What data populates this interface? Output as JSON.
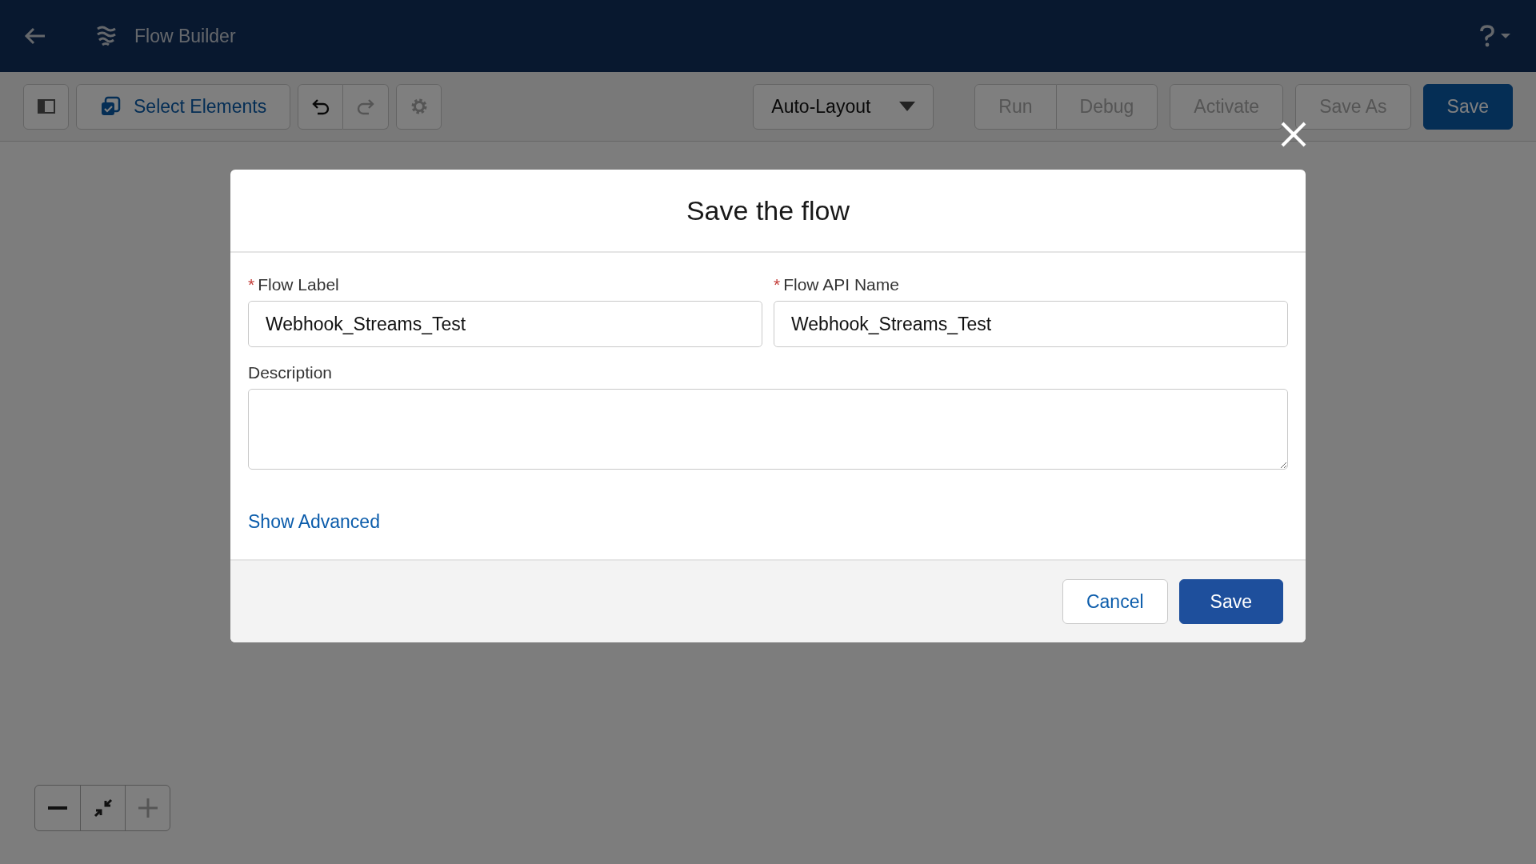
{
  "header": {
    "title": "Flow Builder"
  },
  "toolbar": {
    "select_label": "Select Elements",
    "undo": {
      "disabled": false
    },
    "redo": {
      "disabled": true
    },
    "settings": {
      "disabled": true
    },
    "layout_menu": "Auto-Layout",
    "button_groups": [
      [
        {
          "label": "Run",
          "disabled": true,
          "kind": "neutral"
        },
        {
          "label": "Debug",
          "disabled": true,
          "kind": "neutral"
        }
      ],
      [
        {
          "label": "Activate",
          "disabled": true,
          "kind": "neutral"
        }
      ],
      [
        {
          "label": "Save As",
          "disabled": true,
          "kind": "neutral"
        }
      ],
      [
        {
          "label": "Save",
          "disabled": false,
          "kind": "brand"
        }
      ]
    ]
  },
  "zoom_controls": [
    {
      "kind": "minus",
      "disabled": false
    },
    {
      "kind": "fit",
      "disabled": false
    },
    {
      "kind": "plus",
      "disabled": true
    }
  ],
  "modal": {
    "title": "Save the flow",
    "fields": [
      {
        "required_mark": "*",
        "label": "Flow Label",
        "value": "Webhook_Streams_Test"
      },
      {
        "required_mark": "*",
        "label": "Flow API Name",
        "value": "Webhook_Streams_Test"
      }
    ],
    "description": {
      "label": "Description"
    },
    "link": "Show Advanced",
    "buttons": [
      {
        "label": "Cancel",
        "kind": "neutral"
      },
      {
        "label": "Save",
        "kind": "brand"
      }
    ]
  }
}
